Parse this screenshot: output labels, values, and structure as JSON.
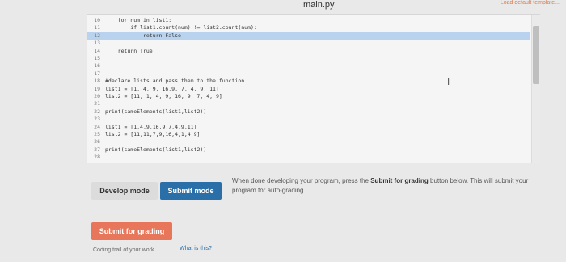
{
  "window": {
    "file_title": "main.py",
    "load_template": "Load default template..."
  },
  "editor": {
    "lines": [
      {
        "num": "10",
        "code": "    for num in list1:"
      },
      {
        "num": "11",
        "code": "        if list1.count(num) != list2.count(num):"
      },
      {
        "num": "12",
        "code": "            return False"
      },
      {
        "num": "13",
        "code": ""
      },
      {
        "num": "14",
        "code": "    return True"
      },
      {
        "num": "15",
        "code": ""
      },
      {
        "num": "16",
        "code": ""
      },
      {
        "num": "17",
        "code": ""
      },
      {
        "num": "18",
        "code": "#declare lists and pass them to the function"
      },
      {
        "num": "19",
        "code": "list1 = [1, 4, 9, 16,9, 7, 4, 9, 11]"
      },
      {
        "num": "20",
        "code": "list2 = [11, 1, 4, 9, 16, 9, 7, 4, 9]"
      },
      {
        "num": "21",
        "code": ""
      },
      {
        "num": "22",
        "code": "print(sameElements(list1,list2))"
      },
      {
        "num": "23",
        "code": ""
      },
      {
        "num": "24",
        "code": "list1 = [1,4,9,16,9,7,4,9,11]"
      },
      {
        "num": "25",
        "code": "list2 = [11,11,7,9,16,4,1,4,9]"
      },
      {
        "num": "26",
        "code": ""
      },
      {
        "num": "27",
        "code": "print(sameElements(list1,list2))"
      },
      {
        "num": "28",
        "code": ""
      }
    ],
    "highlight_false": "False",
    "cursor_glyph": "I"
  },
  "mode": {
    "develop_label": "Develop mode",
    "submit_label": "Submit mode"
  },
  "help": {
    "prefix": "When done developing your program, press the ",
    "bold": "Submit for grading",
    "suffix": " button below. This will submit your program for auto-grading."
  },
  "grading_button": "Submit for grading",
  "footer": {
    "trail": "Coding trail of your work",
    "what": "What is this?"
  },
  "colors": {
    "selection": "#b9d3ee",
    "submit_mode": "#2b6fa8",
    "grading": "#e8765b"
  }
}
